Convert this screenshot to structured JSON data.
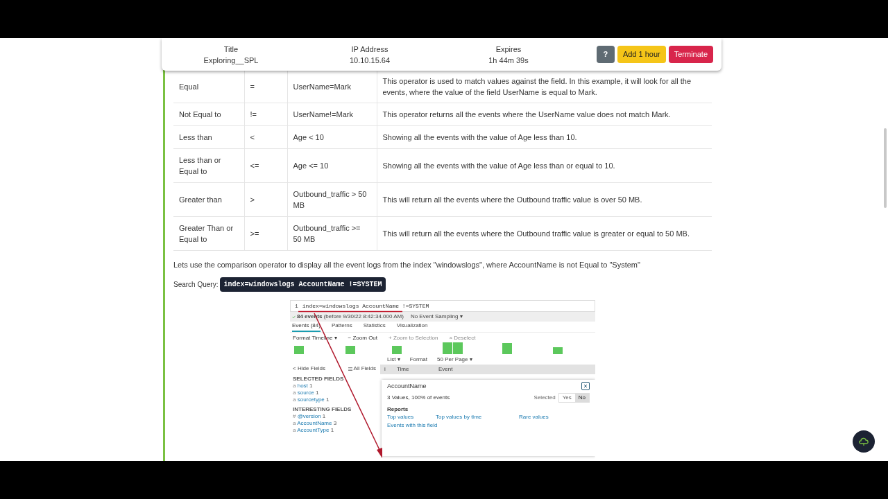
{
  "session_bar": {
    "fields": [
      {
        "label": "Title",
        "value": "Exploring__SPL"
      },
      {
        "label": "IP Address",
        "value": "10.10.15.64"
      },
      {
        "label": "Expires",
        "value": "1h 44m 39s"
      }
    ],
    "buttons": [
      {
        "kind": "help",
        "label": "?"
      },
      {
        "kind": "add",
        "label": "Add 1 hour"
      },
      {
        "kind": "terminate",
        "label": "Terminate"
      }
    ]
  },
  "table": {
    "rows": [
      [
        "Equal",
        "=",
        "UserName=Mark",
        "This operator is used to match values against the field. In this example, it will look for all the events, where the value of the field UserName is equal to Mark."
      ],
      [
        "Not Equal to",
        "!=",
        "UserName!=Mark",
        "This operator returns all the events where the UserName value does not match Mark."
      ],
      [
        "Less than",
        "<",
        "Age < 10",
        "Showing all the events with the value of Age less than 10."
      ],
      [
        "Less than or Equal to",
        "<=",
        "Age <= 10",
        "Showing all the events with the value of Age less than or equal to 10."
      ],
      [
        "Greater than",
        ">",
        "Outbound_traffic > 50 MB",
        "This will return all the events where the Outbound traffic value is over 50 MB."
      ],
      [
        "Greater Than or Equal to",
        ">=",
        "Outbound_traffic >= 50 MB",
        "This will return all the events where the Outbound traffic value is greater or equal to 50 MB."
      ]
    ]
  },
  "paragraph": "Lets use the comparison operator to display all the event logs from the index \"windowslogs\", where AccountName is not Equal to \"System\"",
  "search_query": {
    "label": "Search Query:",
    "code": "index=windowslogs AccountName !=SYSTEM"
  },
  "splunk": {
    "line_number": "1",
    "query": "index=windowslogs AccountName !=SYSTEM",
    "status": "**84 events** (before 9/30/22 8:42:34.000 AM)",
    "sampling": "No Event Sampling ▾",
    "tabs": [
      {
        "label": "Events (84)",
        "selected": true
      },
      {
        "label": "Patterns",
        "selected": false
      },
      {
        "label": "Statistics",
        "selected": false
      },
      {
        "label": "Visualization",
        "selected": false
      }
    ],
    "timeline_tools": [
      {
        "label": "Format Timeline ▾",
        "disabled": false
      },
      {
        "label": "− Zoom Out",
        "disabled": false
      },
      {
        "label": "+ Zoom to Selection",
        "disabled": true
      },
      {
        "label": "× Deselect",
        "disabled": true
      }
    ],
    "view_options": [
      "List ▾",
      "Format",
      "50 Per Page ▾"
    ],
    "hide_fields": "< Hide Fields",
    "all_fields": "All Fields",
    "field_groups": [
      {
        "title": "SELECTED FIELDS",
        "fields": [
          {
            "type": "a",
            "name": "host",
            "count": "1"
          },
          {
            "type": "a",
            "name": "source",
            "count": "1"
          },
          {
            "type": "a",
            "name": "sourcetype",
            "count": "1"
          }
        ]
      },
      {
        "title": "INTERESTING FIELDS",
        "fields": [
          {
            "type": "#",
            "name": "@version",
            "count": "1"
          },
          {
            "type": "a",
            "name": "AccountName",
            "count": "3"
          },
          {
            "type": "a",
            "name": "AccountType",
            "count": "1"
          }
        ]
      }
    ],
    "columns": [
      "i",
      "Time",
      "Event"
    ],
    "popup": {
      "title": "AccountName",
      "summary": "3 Values, 100% of events",
      "selected_label": "Selected",
      "options": [
        {
          "label": "Yes",
          "selected": false
        },
        {
          "label": "No",
          "selected": true
        }
      ],
      "reports_title": "Reports",
      "reports": [
        "Top values",
        "Top values by time",
        "Rare values",
        "Events with this field"
      ]
    }
  }
}
